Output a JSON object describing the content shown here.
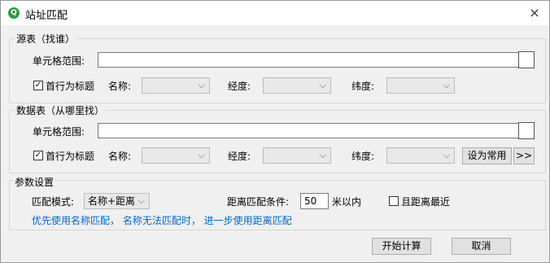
{
  "window": {
    "title": "站址匹配",
    "close_icon": "×",
    "app_icon": "Q"
  },
  "source_group": {
    "legend": "源表（找谁）",
    "cell_range_label": "单元格范围:",
    "cell_range_value": "",
    "first_row_label": "首行为标题",
    "first_row_checked": true,
    "name_label": "名称:",
    "lon_label": "经度:",
    "lat_label": "纬度:"
  },
  "data_group": {
    "legend": "数据表（从哪里找）",
    "cell_range_label": "单元格范围:",
    "cell_range_value": "",
    "first_row_label": "首行为标题",
    "first_row_checked": true,
    "name_label": "名称:",
    "lon_label": "经度:",
    "lat_label": "纬度:",
    "set_default_label": "设为常用",
    "more_label": ">>"
  },
  "params_group": {
    "legend": "参数设置",
    "mode_label": "匹配模式:",
    "mode_value": "名称+距离",
    "distance_label": "距离匹配条件:",
    "distance_value": "50",
    "distance_unit": "米以内",
    "nearest_label": "且距离最近",
    "nearest_checked": false,
    "hint": "优先使用名称匹配， 名称无法匹配时， 进一步使用距离匹配"
  },
  "footer": {
    "start_label": "开始计算",
    "cancel_label": "取消"
  },
  "icons": {
    "dropdown_arrow": "⌵",
    "check_mark": "✓"
  }
}
